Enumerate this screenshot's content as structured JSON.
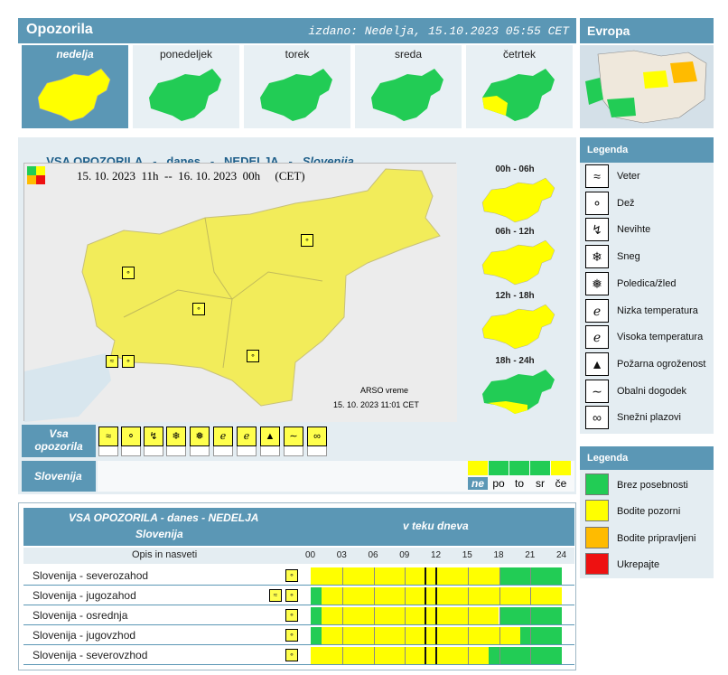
{
  "header": {
    "title": "Opozorila",
    "issued": "izdano: Nedelja, 15.10.2023 05:55 CET",
    "europe": "Evropa"
  },
  "days": [
    {
      "label": "nedelja",
      "state": "yellow"
    },
    {
      "label": "ponedeljek",
      "state": "green"
    },
    {
      "label": "torek",
      "state": "green"
    },
    {
      "label": "sreda",
      "state": "green"
    },
    {
      "label": "četrtek",
      "state": "mixed"
    }
  ],
  "main": {
    "title_a": "VSA OPOZORILA",
    "sep1": "-",
    "title_b": "danes",
    "sep2": "-",
    "title_c": "NEDELJA",
    "sep3": "-",
    "title_d": "Slovenija",
    "period": "15. 10. 2023  11h  --  16. 10. 2023  00h     (CET)",
    "credit_1": "ARSO vreme",
    "credit_2": "15. 10. 2023  11:01 CET"
  },
  "mini_maps": [
    {
      "label": "00h - 06h",
      "state": "yellow"
    },
    {
      "label": "06h - 12h",
      "state": "yellow"
    },
    {
      "label": "12h - 18h",
      "state": "yellow"
    },
    {
      "label": "18h - 24h",
      "state": "green-south-yellow"
    }
  ],
  "warnings_bar": {
    "label_1": "Vsa",
    "label_2": "opozorila",
    "region_label": "Slovenija",
    "icons": [
      "wind-icon",
      "rain-icon",
      "storm-icon",
      "snow-icon",
      "ice-icon",
      "low-temp-icon",
      "high-temp-icon",
      "fire-icon",
      "coastal-icon",
      "avalanche-icon"
    ],
    "days": [
      "ne",
      "po",
      "to",
      "sr",
      "če"
    ],
    "day_colors": [
      "#ffff00",
      "#22cc55",
      "#22cc55",
      "#22cc55",
      "#ffff00"
    ]
  },
  "legend1": {
    "title": "Legenda",
    "items": [
      {
        "label": "Veter",
        "icon": "wind-icon"
      },
      {
        "label": "Dež",
        "icon": "rain-icon"
      },
      {
        "label": "Nevihte",
        "icon": "storm-icon"
      },
      {
        "label": "Sneg",
        "icon": "snow-icon"
      },
      {
        "label": "Poledica/žled",
        "icon": "ice-icon"
      },
      {
        "label": "Nizka temperatura",
        "icon": "low-temp-icon"
      },
      {
        "label": "Visoka temperatura",
        "icon": "high-temp-icon"
      },
      {
        "label": "Požarna ogroženost",
        "icon": "fire-icon"
      },
      {
        "label": "Obalni dogodek",
        "icon": "coastal-icon"
      },
      {
        "label": "Snežni plazovi",
        "icon": "avalanche-icon"
      }
    ]
  },
  "legend2": {
    "title": "Legenda",
    "items": [
      {
        "label": "Brez posebnosti",
        "color": "#22cc55"
      },
      {
        "label": "Bodite pozorni",
        "color": "#ffff00"
      },
      {
        "label": "Bodite pripravljeni",
        "color": "#ffbb00"
      },
      {
        "label": "Ukrepajte",
        "color": "#ee1111"
      }
    ]
  },
  "bottom": {
    "title_1": "VSA OPOZORILA - danes - NEDELJA",
    "title_2": "Slovenija",
    "right_title": "v teku dneva",
    "col_label": "Opis in nasveti",
    "hours": [
      "00",
      "03",
      "06",
      "09",
      "12",
      "15",
      "18",
      "21",
      "24"
    ],
    "now_hours": [
      11,
      12
    ],
    "rows": [
      {
        "name": "Slovenija - severozahod",
        "green_before": 0,
        "yellow_until": 18
      },
      {
        "name": "Slovenija - jugozahod",
        "green_before": 1,
        "yellow_until": 24
      },
      {
        "name": "Slovenija - osrednja",
        "green_before": 1,
        "yellow_until": 18
      },
      {
        "name": "Slovenija - jugovzhod",
        "green_before": 1,
        "yellow_until": 20
      },
      {
        "name": "Slovenija - severovzhod",
        "green_before": 0,
        "yellow_until": 17
      }
    ]
  }
}
